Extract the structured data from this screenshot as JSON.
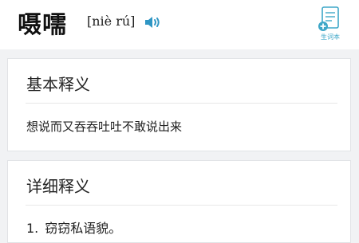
{
  "header": {
    "word": "嗫嚅",
    "pinyin": "[niè rú]",
    "speaker_icon": "speaker-icon",
    "vocab_icon": "notebook-add-icon",
    "vocab_label": "生词本",
    "accent_color": "#3ea7c8"
  },
  "basic": {
    "title": "基本释义",
    "content": "想说而又吞吞吐吐不敢说出来"
  },
  "detail": {
    "title": "详细释义",
    "items": [
      {
        "num": "1.",
        "text": "窃窃私语貌。"
      }
    ]
  }
}
